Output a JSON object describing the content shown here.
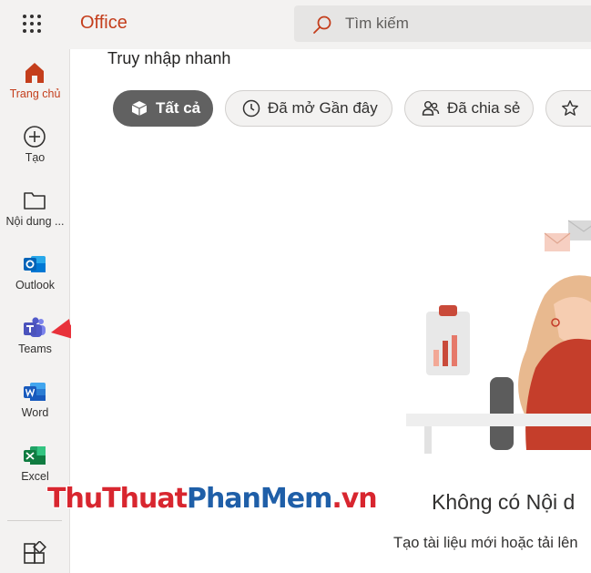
{
  "header": {
    "brand": "Office",
    "search_placeholder": "Tìm kiếm"
  },
  "sidebar": {
    "items": [
      {
        "label": "Trang chủ",
        "icon": "home-icon",
        "active": true
      },
      {
        "label": "Tạo",
        "icon": "plus-circle-icon"
      },
      {
        "label": "Nội dung ...",
        "icon": "folder-icon"
      },
      {
        "label": "Outlook",
        "icon": "outlook-icon"
      },
      {
        "label": "Teams",
        "icon": "teams-icon"
      },
      {
        "label": "Word",
        "icon": "word-icon"
      },
      {
        "label": "Excel",
        "icon": "excel-icon"
      }
    ],
    "apps_icon": "all-apps-icon"
  },
  "main": {
    "quick_access_title": "Truy nhập nhanh",
    "filters": [
      {
        "label": "Tất cả",
        "icon": "cube-icon",
        "selected": true
      },
      {
        "label": "Đã mở Gần đây",
        "icon": "clock-icon"
      },
      {
        "label": "Đã chia sẻ",
        "icon": "people-icon"
      },
      {
        "label": "",
        "icon": "star-icon"
      }
    ],
    "empty_title": "Không có Nội d",
    "empty_subtitle": "Tạo tài liệu mới hoặc tải lên"
  },
  "watermark": {
    "part1": "ThuThuat",
    "part2": "PhanMem",
    "part3": ".vn"
  },
  "colors": {
    "brand": "#c43e1c",
    "arrow": "#e8313a",
    "selected_pill": "#616161"
  }
}
